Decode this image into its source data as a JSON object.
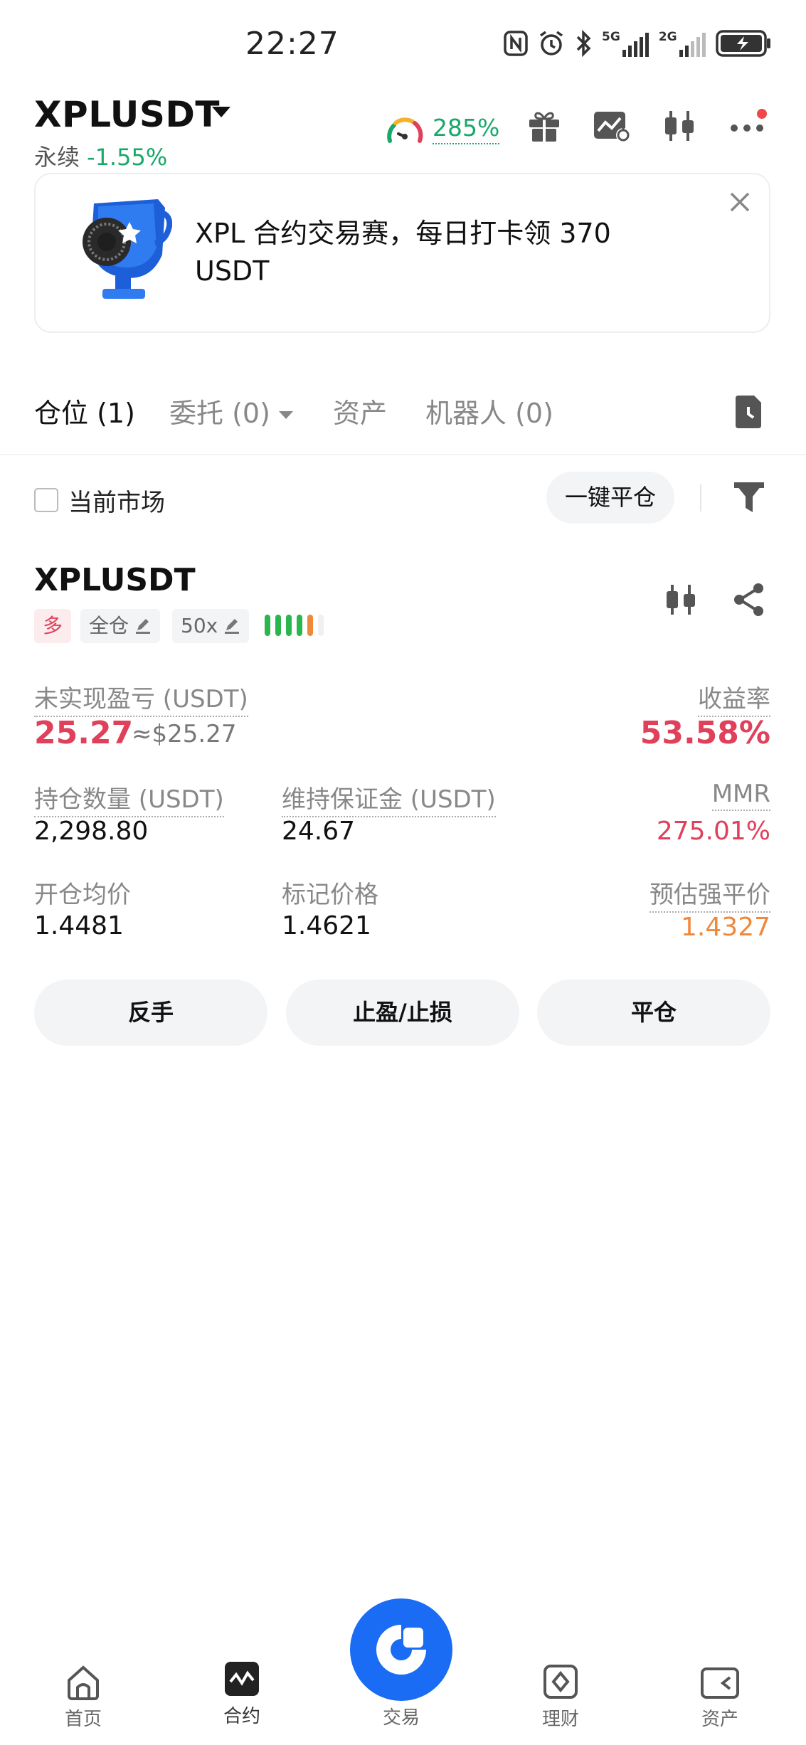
{
  "status_bar": {
    "time": "22:27",
    "icons": [
      "nfc-icon",
      "alarm-icon",
      "bluetooth-icon",
      "signal-5g-icon",
      "signal-2g-icon",
      "battery-icon"
    ],
    "net1": "5G",
    "net2": "2G"
  },
  "header": {
    "symbol": "XPLUSDT",
    "contract_type": "永续",
    "change": "-1.55%",
    "gauge_value": "285%",
    "icons": [
      "gauge-icon",
      "gift-icon",
      "chart-icon",
      "candlestick-icon",
      "more-icon"
    ],
    "colors": {
      "positive": "#19a86a",
      "negative": "#e0405a",
      "notification": "#f04848"
    }
  },
  "banner": {
    "text": "XPL 合约交易赛，每日打卡领 370 USDT"
  },
  "tabs": [
    {
      "label": "仓位 (1)"
    },
    {
      "label": "委托 (0)"
    },
    {
      "label": "资产"
    },
    {
      "label": "机器人 (0)"
    }
  ],
  "filter": {
    "current_market_label": "当前市场",
    "checked": false,
    "close_all_label": "一键平仓"
  },
  "position": {
    "symbol": "XPLUSDT",
    "side": "多",
    "margin_mode": "全仓",
    "leverage": "50x",
    "pnl_label": "未实现盈亏 (USDT)",
    "pnl_value": "25.27",
    "pnl_usd": "≈$25.27",
    "roe_label": "收益率",
    "roe_value": "53.58%",
    "size_label": "持仓数量 (USDT)",
    "size_value": "2,298.80",
    "maint_margin_label": "维持保证金 (USDT)",
    "maint_margin_value": "24.67",
    "mmr_label": "MMR",
    "mmr_value": "275.01%",
    "entry_label": "开仓均价",
    "entry_value": "1.4481",
    "mark_label": "标记价格",
    "mark_value": "1.4621",
    "liq_label": "预估强平价",
    "liq_value": "1.4327",
    "buttons": {
      "reverse": "反手",
      "tpsl": "止盈/止损",
      "close": "平仓"
    }
  },
  "bottom_nav": [
    {
      "label": "首页"
    },
    {
      "label": "合约"
    },
    {
      "label": "交易"
    },
    {
      "label": "理财"
    },
    {
      "label": "资产"
    }
  ]
}
